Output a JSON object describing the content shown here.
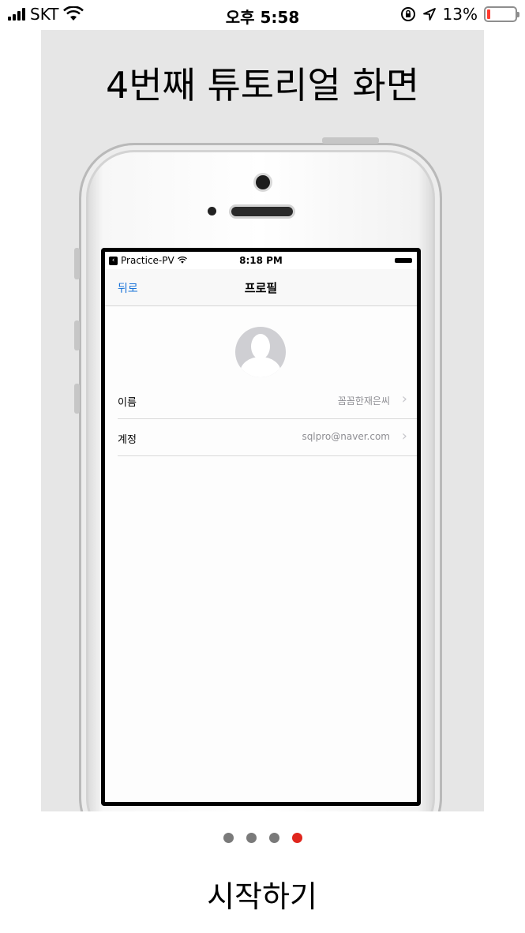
{
  "status_bar": {
    "carrier": "SKT",
    "time": "오후 5:58",
    "battery_percent": "13%",
    "battery_level": 0.13,
    "icons": [
      "signal-icon",
      "wifi-icon",
      "orientation-lock-icon",
      "location-arrow-icon",
      "battery-icon"
    ],
    "battery_color": "#ff3b30"
  },
  "tutorial": {
    "title": "4번째 튜토리얼 화면",
    "screenshot": {
      "status": {
        "app": "Practice-PV",
        "time": "8:18 PM"
      },
      "nav": {
        "back_label": "뒤로",
        "title": "프로필"
      },
      "rows": [
        {
          "label": "이름",
          "value": "꼼꼼한재은씨"
        },
        {
          "label": "계정",
          "value": "sqlpro@naver.com"
        }
      ],
      "link_color": "#1a73d9"
    }
  },
  "page_indicator": {
    "count": 4,
    "current": 4,
    "active_color": "#e0261d"
  },
  "start_button": {
    "label": "시작하기"
  }
}
